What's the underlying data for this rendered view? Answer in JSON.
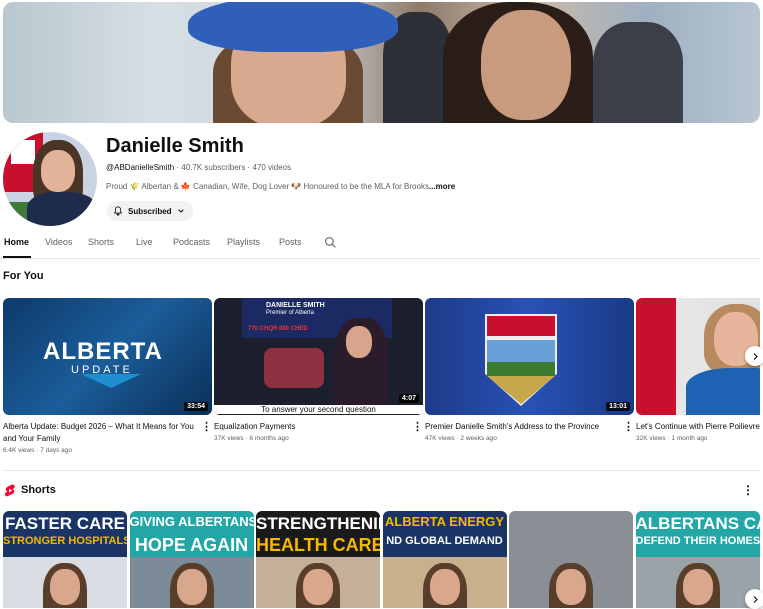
{
  "channel": {
    "name": "Danielle Smith",
    "handle": "@ABDanielleSmith",
    "subscribers": "40.7K subscribers",
    "videos": "470 videos",
    "description": "Proud 🌾 Albertan & 🍁 Canadian, Wife, Dog Lover 🐶 Honoured to be the MLA for Brooks",
    "more_label": "...more",
    "subscribe_label": "Subscribed"
  },
  "tabs": [
    {
      "label": "Home"
    },
    {
      "label": "Videos"
    },
    {
      "label": "Shorts"
    },
    {
      "label": "Live"
    },
    {
      "label": "Podcasts"
    },
    {
      "label": "Playlists"
    },
    {
      "label": "Posts"
    }
  ],
  "for_you": {
    "title": "For You",
    "videos": [
      {
        "title": "Alberta Update: Budget 2026 – What It Means for You and Your Family",
        "views": "6.4K views",
        "age": "7 days ago",
        "duration": "33:54",
        "thumb_text": "ALBERTA",
        "thumb_sub": "UPDATE"
      },
      {
        "title": "Equalization Payments",
        "views": "37K views",
        "age": "6 months ago",
        "duration": "4:07",
        "thumb_heading": "DANIELLE SMITH",
        "thumb_sub": "Premier of Alberta",
        "thumb_radio": "770 CHQR  880 CHED",
        "thumb_caption": "To answer your second question"
      },
      {
        "title": "Premier Danielle Smith's Address to the Province",
        "views": "47K views",
        "age": "2 weeks ago",
        "duration": "13:01"
      },
      {
        "title": "Let's Continue with Pierre Poilievre",
        "views": "32K views",
        "age": "1 month ago",
        "duration": ""
      }
    ]
  },
  "shorts": {
    "title": "Shorts",
    "items": [
      {
        "line1": "FASTER CARE",
        "line2": "STRONGER HOSPITALS",
        "band": "#1a3565",
        "c1": "#ffffff",
        "c2": "#f5b800"
      },
      {
        "line1": "GIVING ALBERTANS",
        "line2": "HOPE AGAIN",
        "band": "#22a6a6",
        "c1": "#ffffff",
        "c2": "#ffffff"
      },
      {
        "line1": "STRENGTHENING",
        "line2": "HEALTH CARE",
        "band": "#1a1a1a",
        "c1": "#ffffff",
        "c2": "#f5b800"
      },
      {
        "line1": "ALBERTA ENERGY",
        "line2": "ND GLOBAL DEMAND",
        "band": "#1a3565",
        "c1": "#f5b800",
        "c2": "#ffffff"
      },
      {
        "line1": "",
        "line2": "",
        "band": "#8a8f96",
        "c1": "#ffffff",
        "c2": "#ffffff"
      },
      {
        "line1": "ALBERTANS CAN",
        "line2": "DEFEND THEIR HOMES",
        "band": "#22a6a6",
        "c1": "#ffffff",
        "c2": "#ffffff"
      }
    ]
  },
  "icons": {
    "search": "search-icon",
    "bell": "bell-icon",
    "next": "chevron-right-icon",
    "shorts": "shorts-logo-icon",
    "more": "more-vert-icon"
  }
}
